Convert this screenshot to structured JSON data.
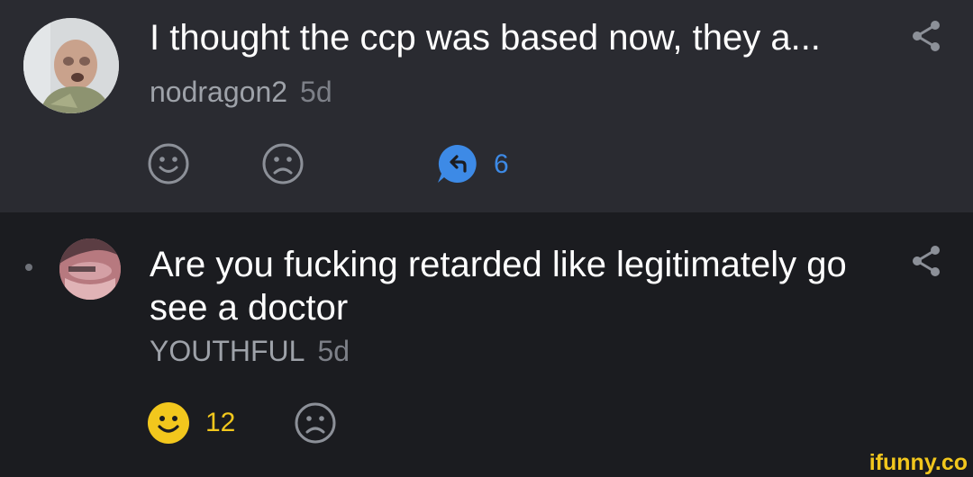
{
  "thread": {
    "parent": {
      "text": "I thought the ccp was based now, they a...",
      "username": "nodragon2",
      "age": "5d",
      "reactions": {
        "smile_count": "",
        "frown_count": ""
      },
      "replies": {
        "count": "6"
      }
    },
    "reply": {
      "text": "Are you fucking retarded like legitimately go see a doctor",
      "username": "YOUTHFUL",
      "age": "5d",
      "reactions": {
        "smile_count": "12",
        "frown_count": ""
      }
    }
  },
  "watermark": "ifunny.co",
  "colors": {
    "background_top": "#2a2b31",
    "background_bottom": "#1b1c20",
    "accent_blue": "#3d8ae6",
    "accent_yellow": "#f2c71d",
    "muted_text": "#9ea2a9",
    "icon_gray": "#8c9098"
  },
  "icons": [
    "share-icon",
    "smile-icon",
    "frown-icon",
    "reply-bubble-icon"
  ]
}
